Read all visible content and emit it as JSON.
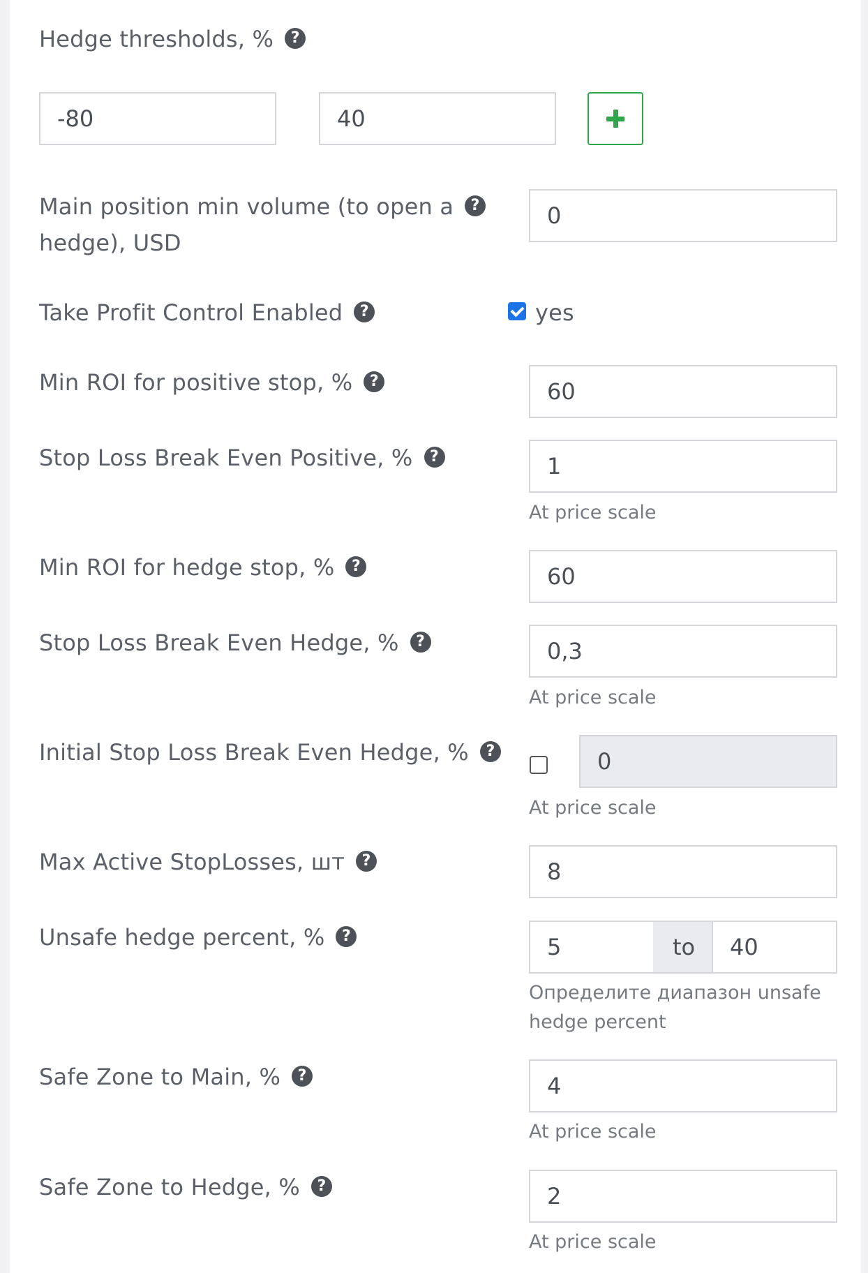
{
  "hedge_thresholds": {
    "label": "Hedge thresholds, %",
    "values": [
      "-80",
      "40"
    ],
    "add_symbol": "+"
  },
  "fields": {
    "main_min_volume": {
      "label_line1": "Main position min volume (to open a",
      "label_line2": "hedge), USD",
      "value": "0"
    },
    "take_profit_control": {
      "label": "Take Profit Control Enabled",
      "checked": true,
      "checkbox_label": "yes"
    },
    "min_roi_positive": {
      "label": "Min ROI for positive stop, %",
      "value": "60"
    },
    "sl_break_even_positive": {
      "label": "Stop Loss Break Even Positive, %",
      "value": "1",
      "hint": "At price scale"
    },
    "min_roi_hedge": {
      "label": "Min ROI for hedge stop, %",
      "value": "60"
    },
    "sl_break_even_hedge": {
      "label": "Stop Loss Break Even Hedge, %",
      "value": "0,3",
      "hint": "At price scale"
    },
    "initial_sl_break_even_hedge": {
      "label": "Initial Stop Loss Break Even Hedge, %",
      "checked": false,
      "value": "0",
      "hint": "At price scale"
    },
    "max_active_stoplosses": {
      "label": "Max Active StopLosses, шт",
      "value": "8"
    },
    "unsafe_hedge_percent": {
      "label": "Unsafe hedge percent, %",
      "from": "5",
      "to_label": "to",
      "to": "40",
      "hint_line1": "Определите диапазон unsafe",
      "hint_line2": "hedge percent"
    },
    "safe_zone_main": {
      "label": "Safe Zone to Main, %",
      "value": "4",
      "hint": "At price scale"
    },
    "safe_zone_hedge": {
      "label": "Safe Zone to Hedge, %",
      "value": "2",
      "hint": "At price scale"
    }
  },
  "help_icon_glyph": "?",
  "colors": {
    "accent_green": "#2ea64a",
    "checkbox_blue": "#1a73e8",
    "help_icon": "#4d5258"
  }
}
